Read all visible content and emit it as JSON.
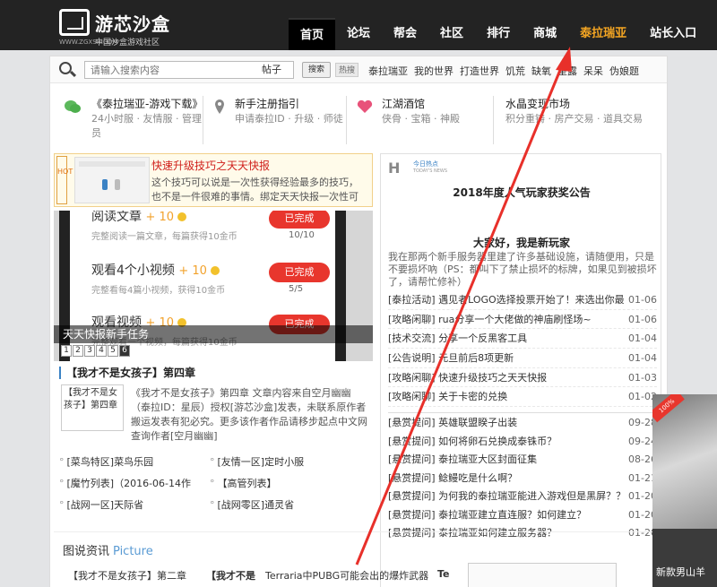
{
  "header": {
    "logo_title": "游芯沙盒",
    "logo_url": "WWW.ZGXSH.COM",
    "logo_slogan": "中国沙盒游戏社区",
    "nav": [
      "首页",
      "论坛",
      "帮会",
      "社区",
      "排行",
      "商城",
      "泰拉瑞亚",
      "站长入口"
    ]
  },
  "search": {
    "placeholder": "请输入搜索内容",
    "select_value": "帖子",
    "button_label": "搜索",
    "hot_tag": "热搜",
    "hot_links": [
      "泰拉瑞亚",
      "我的世界",
      "打造世界",
      "饥荒",
      "缺氧",
      "星露",
      "呆呆",
      "伪娘题"
    ]
  },
  "quick": [
    {
      "title": "《泰拉瑞亚-游戏下载》",
      "links": "24小时服 · 友情服 · 管理员"
    },
    {
      "title": "新手注册指引",
      "links": "申请泰拉ID · 升级 · 师徒"
    },
    {
      "title": "江湖酒馆",
      "links": "侠骨 · 宝箱 · 神殿"
    },
    {
      "title": "水晶变现市场",
      "links": "积分重铸 · 房产交易 · 道具交易"
    }
  ],
  "promo": {
    "hot_label": "HOT",
    "title": "快速升级技巧之天天快报",
    "desc": "这个技巧可以说是一次性获得经验最多的技巧，也不是一件很难的事情。绑定天天快报一次性可以获"
  },
  "slider": {
    "tasks": [
      {
        "title": "阅读文章",
        "points": "+ 10",
        "desc": "完整阅读一篇文章，每篇获得10金币",
        "button": "已完成",
        "count": "10/10"
      },
      {
        "title": "观看4个小视频",
        "points": "+ 10",
        "desc": "完整看每4篇小视频，获得10金币",
        "button": "已完成",
        "count": "5/5"
      },
      {
        "title": "观看视频",
        "points": "+ 10",
        "desc": "完整观看一个视频，每篇获得10金币",
        "button": "已完成",
        "count": ""
      }
    ],
    "caption": "天天快报新手任务",
    "dots": [
      "1",
      "2",
      "3",
      "4",
      "5",
      "6"
    ]
  },
  "article": {
    "title": "【我才不是女孩子】第四章",
    "thumb": "【我才不是女孩子】第四章",
    "body": "《我才不是女孩子》第四章 文章内容来自空月幽幽（泰拉ID：星辰）授权[游芯沙盒]发表，未联系原作者搬运发表有犯必究。更多该作者作品请移步起点中文网查询作者[空月幽幽]"
  },
  "links": [
    "[菜鸟特区]菜鸟乐园",
    "[友情一区]定时小服",
    "[魔竹列表]（2016-06-14作",
    "【高管列表】",
    "[战网一区]天际省",
    "[战网零区]通灵省"
  ],
  "right": {
    "hot_cn": "今日热点",
    "hot_en": "TODAY'S NEWS",
    "headline": "2018年度人气玩家获奖公告",
    "welcome": "大家好，我是新玩家",
    "intro": "我在那两个新手服务器里建了许多基础设施，请随便用，只是不要损坏吶（PS：都叫下了禁止损坏的标牌，如果见到被损坏了，请帮忙修补）",
    "news": [
      {
        "title": "[泰拉活动] 遇见者LOGO选择投票开始了！来选出你最心",
        "date": "01-06"
      },
      {
        "title": "[攻略闲聊] rua分享一个大佬做的神庙刷怪场~",
        "date": "01-06"
      },
      {
        "title": "[技术交流] 分享一个反黑客工具",
        "date": "01-04"
      },
      {
        "title": "[公告说明] 元旦前后8项更新",
        "date": "01-04"
      },
      {
        "title": "[攻略闲聊] 快速升级技巧之天天快报",
        "date": "01-03"
      },
      {
        "title": "[攻略闲聊] 关于卡密的兑换",
        "date": "01-02"
      }
    ],
    "questions": [
      {
        "title": "[悬赏提问] 英雄联盟睽子出装",
        "date": "09-28"
      },
      {
        "title": "[悬赏提问] 如何将卵石兑换成泰铢币？",
        "date": "09-24"
      },
      {
        "title": "[悬赏提问] 泰拉瑞亚大区封面征集",
        "date": "08-26"
      },
      {
        "title": "[悬赏提问] 鲶鳗吃是什么啊？",
        "date": "01-21"
      },
      {
        "title": "[悬赏提问] 为何我的泰拉瑞亚能进入游戏但是黑屏？？？",
        "date": "01-20"
      },
      {
        "title": "[悬赏提问] 泰拉瑞亚建立直连服？如何建立？",
        "date": "01-20"
      },
      {
        "title": "[悬赏提问] 泰拉瑞亚如何建立服务器？",
        "date": "01-20"
      }
    ]
  },
  "pictures": {
    "title": "图说资讯",
    "title_en": "Picture",
    "items": [
      "【我才不是女孩子】第二章",
      "【我才不是",
      "Terraria中PUBG可能会出的爆炸武器",
      "Te"
    ]
  },
  "ad": {
    "badge": "100%",
    "text": "新款男山羊"
  }
}
